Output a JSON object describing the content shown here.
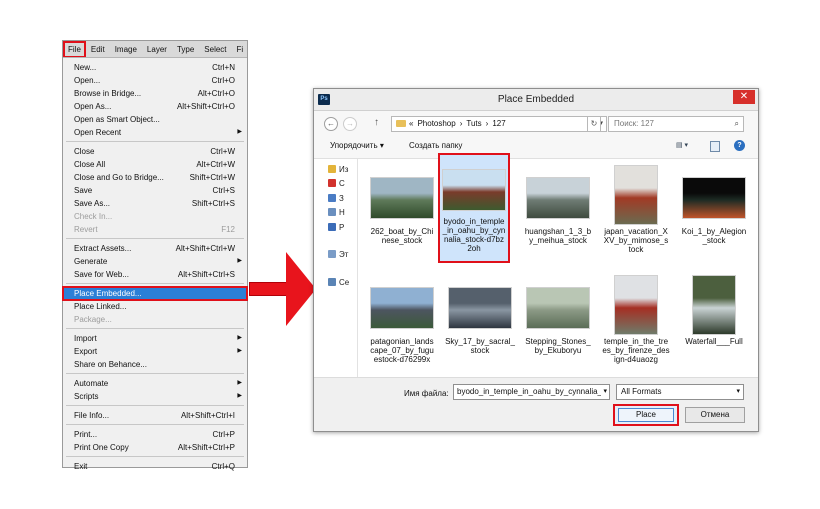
{
  "menubar": [
    "File",
    "Edit",
    "Image",
    "Layer",
    "Type",
    "Select",
    "Fi"
  ],
  "file_menu": {
    "groups": [
      [
        {
          "label": "New...",
          "shortcut": "Ctrl+N"
        },
        {
          "label": "Open...",
          "shortcut": "Ctrl+O"
        },
        {
          "label": "Browse in Bridge...",
          "shortcut": "Alt+Ctrl+O"
        },
        {
          "label": "Open As...",
          "shortcut": "Alt+Shift+Ctrl+O"
        },
        {
          "label": "Open as Smart Object...",
          "shortcut": ""
        },
        {
          "label": "Open Recent",
          "shortcut": "",
          "submenu": true
        }
      ],
      [
        {
          "label": "Close",
          "shortcut": "Ctrl+W"
        },
        {
          "label": "Close All",
          "shortcut": "Alt+Ctrl+W"
        },
        {
          "label": "Close and Go to Bridge...",
          "shortcut": "Shift+Ctrl+W"
        },
        {
          "label": "Save",
          "shortcut": "Ctrl+S"
        },
        {
          "label": "Save As...",
          "shortcut": "Shift+Ctrl+S"
        },
        {
          "label": "Check In...",
          "shortcut": "",
          "disabled": true
        },
        {
          "label": "Revert",
          "shortcut": "F12",
          "disabled": true
        }
      ],
      [
        {
          "label": "Extract Assets...",
          "shortcut": "Alt+Shift+Ctrl+W"
        },
        {
          "label": "Generate",
          "shortcut": "",
          "submenu": true
        },
        {
          "label": "Save for Web...",
          "shortcut": "Alt+Shift+Ctrl+S"
        }
      ],
      [
        {
          "label": "Place Embedded...",
          "shortcut": "",
          "highlight": true
        },
        {
          "label": "Place Linked...",
          "shortcut": ""
        },
        {
          "label": "Package...",
          "shortcut": "",
          "disabled": true
        }
      ],
      [
        {
          "label": "Import",
          "shortcut": "",
          "submenu": true
        },
        {
          "label": "Export",
          "shortcut": "",
          "submenu": true
        },
        {
          "label": "Share on Behance...",
          "shortcut": ""
        }
      ],
      [
        {
          "label": "Automate",
          "shortcut": "",
          "submenu": true
        },
        {
          "label": "Scripts",
          "shortcut": "",
          "submenu": true
        }
      ],
      [
        {
          "label": "File Info...",
          "shortcut": "Alt+Shift+Ctrl+I"
        }
      ],
      [
        {
          "label": "Print...",
          "shortcut": "Ctrl+P"
        },
        {
          "label": "Print One Copy",
          "shortcut": "Alt+Shift+Ctrl+P"
        }
      ],
      [
        {
          "label": "Exit",
          "shortcut": "Ctrl+Q"
        }
      ]
    ]
  },
  "dialog": {
    "app_icon": "Ps",
    "title": "Place Embedded",
    "close": "✕",
    "back": "←",
    "forward": "→",
    "up": "↑",
    "path": [
      "«",
      "Photoshop",
      "›",
      "Tuts",
      "›",
      "127"
    ],
    "refresh": "↻",
    "search_placeholder": "Поиск: 127",
    "organize": "Упорядочить ▾",
    "new_folder": "Создать папку",
    "view": "▤ ▾",
    "help": "?",
    "nav_items": [
      {
        "label": "Из",
        "color": "#e3b43a"
      },
      {
        "label": "С",
        "color": "#d2322d"
      },
      {
        "label": "З",
        "color": "#4a7cc4"
      },
      {
        "label": "Н",
        "color": "#6a8fbf"
      },
      {
        "label": "Р",
        "color": "#3b6cb8"
      },
      {
        "label": "Эт",
        "color": "#7a9cc7"
      },
      {
        "label": "Се",
        "color": "#5a84b5"
      }
    ],
    "files": [
      {
        "name": "262_boat_by_Chinese_stock",
        "caption": "262_boat_by_Chi\nnese_stock",
        "palette": [
          "#9fb6c4",
          "#5f7a5a",
          "#2f4a2a"
        ],
        "selected": false
      },
      {
        "name": "byodo_in_temple_in_oahu_by_cynnalia_stock-d7bz2oh",
        "caption": "byodo_in_temple\n_in_oahu_by_cyn\nnalia_stock-d7bz\n2oh",
        "palette": [
          "#c9dff0",
          "#7a3b2b",
          "#3d5a2e"
        ],
        "selected": true
      },
      {
        "name": "huangshan_1_3_by_meihua_stock",
        "caption": "huangshan_1_3_b\ny_meihua_stock",
        "palette": [
          "#c8d2d8",
          "#6f7c74",
          "#3f4b3f"
        ],
        "selected": false
      },
      {
        "name": "japan_vacation_XXV_by_mimose_stock",
        "caption": "japan_vacation_X\nXV_by_mimose_s\ntock",
        "palette": [
          "#e2e0dc",
          "#a13a25",
          "#6b6b50"
        ],
        "selected": false
      },
      {
        "name": "Koi_1_by_Alegion_stock",
        "caption": "Koi_1_by_Alegion\n_stock",
        "palette": [
          "#0a0a0a",
          "#1d2b24",
          "#c0542a"
        ],
        "selected": false
      },
      {
        "name": "patagonian_landscape_07_by_fugu estock-d76299x",
        "caption": "patagonian_lands\ncape_07_by_fugu\nestock-d76299x",
        "palette": [
          "#8fb0d2",
          "#4d5560",
          "#3c5a3a"
        ],
        "selected": false
      },
      {
        "name": "Sky_17_by_sacral_stock",
        "caption": "Sky_17_by_sacral_\nstock",
        "palette": [
          "#55606c",
          "#8a96a2",
          "#2e3640"
        ],
        "selected": false
      },
      {
        "name": "Stepping_Stones_by_Ekuboryu",
        "caption": "Stepping_Stones_\nby_Ekuboryu",
        "palette": [
          "#b9c6b4",
          "#8c9a86",
          "#5b6d57"
        ],
        "selected": false
      },
      {
        "name": "temple_in_the_trees_by_firenze_design-d4uaozg",
        "caption": "temple_in_the_tre\nes_by_firenze_des\nign-d4uaozg",
        "palette": [
          "#dfe1e4",
          "#a52f23",
          "#6f7b6a"
        ],
        "selected": false
      },
      {
        "name": "Waterfall___Full",
        "caption": "Waterfall___Full",
        "palette": [
          "#4c5f3e",
          "#c9d3d4",
          "#2d3a2a"
        ],
        "selected": false
      }
    ],
    "filename_label": "Имя файла:",
    "filename_value": "byodo_in_temple_in_oahu_by_cynnalia_",
    "format_value": "All Formats",
    "place_label": "Place",
    "cancel_label": "Отмена"
  }
}
